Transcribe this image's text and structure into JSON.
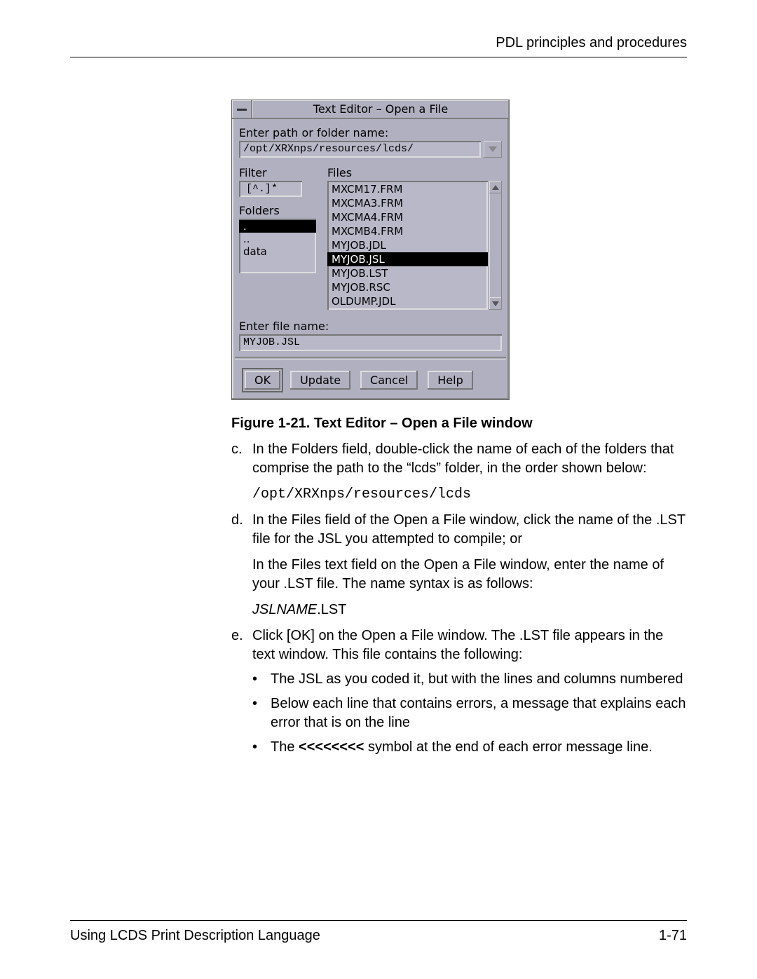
{
  "header": {
    "section_title": "PDL principles and procedures"
  },
  "dialog": {
    "title": "Text Editor – Open a File",
    "path_label": "Enter path or folder name:",
    "path_value": "/opt/XRXnps/resources/lcds/",
    "filter_label": "Filter",
    "filter_value": "[^.]*",
    "folders_label": "Folders",
    "folders": [
      {
        "name": ".",
        "selected": true
      },
      {
        "name": "..",
        "selected": false
      },
      {
        "name": "data",
        "selected": false
      }
    ],
    "files_label": "Files",
    "files": [
      {
        "name": "MXCM17.FRM",
        "selected": false
      },
      {
        "name": "MXCMA3.FRM",
        "selected": false
      },
      {
        "name": "MXCMA4.FRM",
        "selected": false
      },
      {
        "name": "MXCMB4.FRM",
        "selected": false
      },
      {
        "name": "MYJOB.JDL",
        "selected": false
      },
      {
        "name": "MYJOB.JSL",
        "selected": true
      },
      {
        "name": "MYJOB.LST",
        "selected": false
      },
      {
        "name": "MYJOB.RSC",
        "selected": false
      },
      {
        "name": "OLDUMP.JDL",
        "selected": false
      }
    ],
    "filename_label": "Enter file name:",
    "filename_value": "MYJOB.JSL",
    "buttons": {
      "ok": "OK",
      "update": "Update",
      "cancel": "Cancel",
      "help": "Help"
    }
  },
  "caption": "Figure 1-21. Text Editor – Open a File window",
  "steps": {
    "c": {
      "label": "c.",
      "text": "In the Folders field, double-click the name of each of the folders that comprise the path to the “lcds” folder, in the order shown below:",
      "path": "/opt/XRXnps/resources/lcds"
    },
    "d": {
      "label": "d.",
      "text1": "In the Files field of the Open a File window, click the name of the .LST file for the JSL you attempted to compile; or",
      "text2": "In the Files text field on the Open a File window, enter the name of your .LST file. The name syntax is as follows:",
      "syntax_italic": "JSLNAME",
      "syntax_rest": ".LST"
    },
    "e": {
      "label": "e.",
      "text": "Click [OK] on the Open a File window. The  .LST file appears in the text window. This file contains the following:",
      "bullets": [
        "The JSL as you coded it, but with the lines and columns numbered",
        "Below each line that contains errors, a message that explains each error that is on the line",
        {
          "pre": "The ",
          "sym": "<<<<<<<<",
          "post": " symbol at the end of each error message line."
        }
      ]
    }
  },
  "footer": {
    "left": "Using LCDS Print Description Language",
    "right": "1-71"
  }
}
